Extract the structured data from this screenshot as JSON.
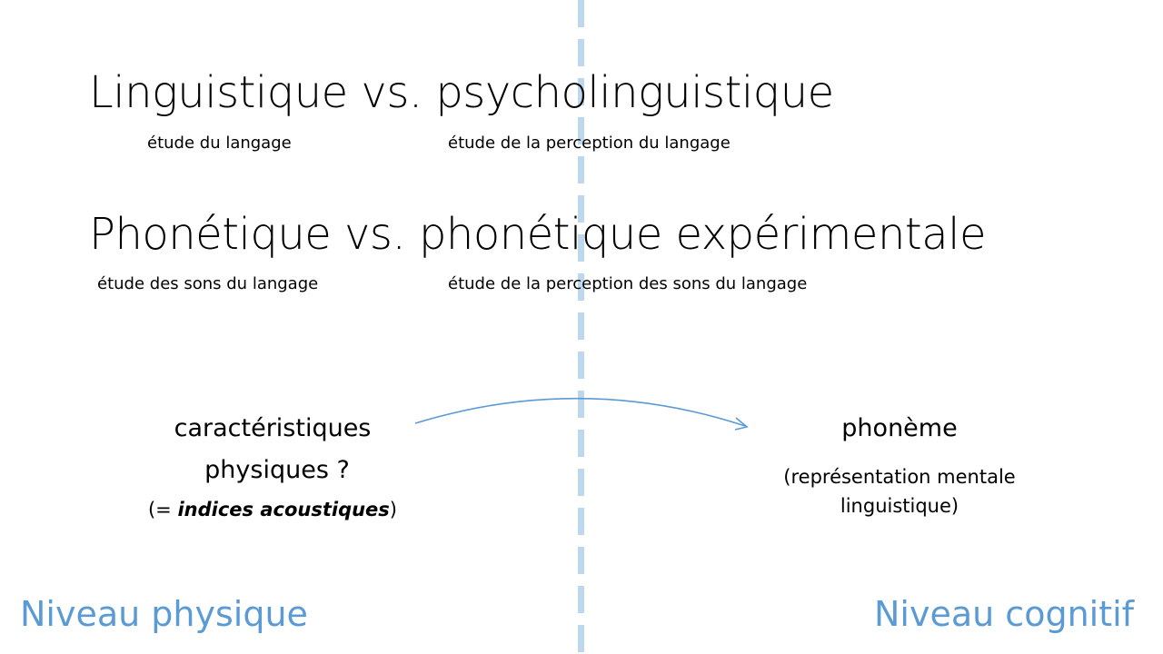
{
  "titles": {
    "line1": "Linguistique vs. psycholinguistique",
    "line2": "Phonétique vs. phonétique expérimentale"
  },
  "subtitles": {
    "line1_left": "étude du langage",
    "line1_right": "étude de la perception du langage",
    "line2_left": "étude des sons du langage",
    "line2_right": "étude de la perception des sons du langage"
  },
  "left_block": {
    "line1": "caractéristiques",
    "line2": "physiques  ?",
    "paren_open": "(= ",
    "bold_italic": "indices acoustiques",
    "paren_close": ")"
  },
  "right_block": {
    "title": "phonème",
    "desc_line1": "(représentation mentale",
    "desc_line2": "linguistique)"
  },
  "levels": {
    "left": "Niveau physique",
    "right": "Niveau cognitif"
  },
  "colors": {
    "accent": "#5b9bd5",
    "divider": "#bdd7ee",
    "arrow": "#5b9bd5"
  }
}
